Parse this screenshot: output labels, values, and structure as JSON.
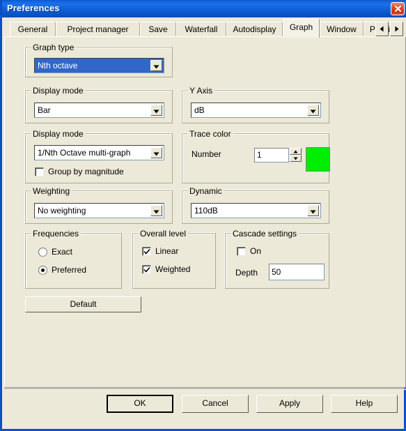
{
  "window": {
    "title": "Preferences",
    "close_icon": "close-icon",
    "border_color": "#0a50c8",
    "face_color": "#ece9d8"
  },
  "tabs": {
    "items": [
      {
        "label": "General",
        "active": false
      },
      {
        "label": "Project manager",
        "active": false
      },
      {
        "label": "Save",
        "active": false
      },
      {
        "label": "Waterfall",
        "active": false
      },
      {
        "label": "Autodisplay",
        "active": false
      },
      {
        "label": "Graph",
        "active": true
      },
      {
        "label": "Window",
        "active": false
      },
      {
        "label": "Physic",
        "active": false
      }
    ],
    "scroll_left_icon": "triangle-left-icon",
    "scroll_right_icon": "triangle-right-icon"
  },
  "graph_type": {
    "legend": "Graph type",
    "value": "Nth octave",
    "selected": true,
    "arrow_icon": "chevron-down-icon"
  },
  "display_mode_1": {
    "legend": "Display mode",
    "value": "Bar",
    "arrow_icon": "chevron-down-icon"
  },
  "display_mode_2": {
    "legend": "Display mode",
    "value": "1/Nth Octave multi-graph",
    "arrow_icon": "chevron-down-icon",
    "group_by_magnitude": {
      "label": "Group by magnitude",
      "checked": false
    }
  },
  "weighting": {
    "legend": "Weighting",
    "value": "No weighting",
    "arrow_icon": "chevron-down-icon"
  },
  "y_axis": {
    "legend": "Y Axis",
    "value": "dB",
    "arrow_icon": "chevron-down-icon"
  },
  "trace_color": {
    "legend": "Trace color",
    "number_label": "Number",
    "number_value": "1",
    "color": "#00ee00",
    "spin_up_icon": "triangle-up-icon",
    "spin_down_icon": "triangle-down-icon"
  },
  "dynamic": {
    "legend": "Dynamic",
    "value": "110dB",
    "arrow_icon": "chevron-down-icon"
  },
  "frequencies": {
    "legend": "Frequencies",
    "options": [
      {
        "label": "Exact",
        "selected": false
      },
      {
        "label": "Preferred",
        "selected": true
      }
    ]
  },
  "overall_level": {
    "legend": "Overall level",
    "options": [
      {
        "label": "Linear",
        "checked": true
      },
      {
        "label": "Weighted",
        "checked": true
      }
    ]
  },
  "cascade_settings": {
    "legend": "Cascade settings",
    "on": {
      "label": "On",
      "checked": false
    },
    "depth_label": "Depth",
    "depth_value": "50"
  },
  "buttons": {
    "default": "Default",
    "ok": "OK",
    "cancel": "Cancel",
    "apply": "Apply",
    "help": "Help"
  }
}
